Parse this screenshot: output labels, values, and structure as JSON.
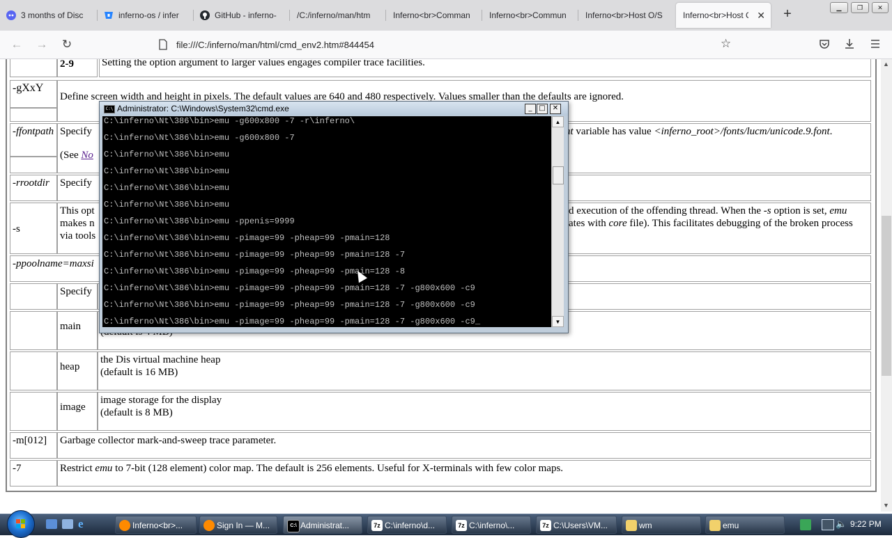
{
  "browser": {
    "tabs": [
      {
        "label": "3 months of Disc",
        "icon": "discord-icon"
      },
      {
        "label": "inferno-os / infer",
        "icon": "bitbucket-icon"
      },
      {
        "label": "GitHub - inferno-",
        "icon": "github-icon"
      },
      {
        "label": "/C:/inferno/man/htm",
        "icon": "none"
      },
      {
        "label": "Inferno<br>Comman",
        "icon": "none"
      },
      {
        "label": "Inferno<br>Commun",
        "icon": "none"
      },
      {
        "label": "Inferno<br>Host O/S",
        "icon": "none"
      },
      {
        "label": "Inferno<br>Host O",
        "icon": "none",
        "active": true
      }
    ],
    "url": "file:///C:/inferno/man/html/cmd_env2.htm#844454"
  },
  "page": {
    "row_29": {
      "flag": "2-9",
      "text": "Setting the option argument to larger values engages compiler trace facilities."
    },
    "row_g": {
      "flag": "-gXxY",
      "text": "Define screen width and height in pixels. The default values are 640 and 480 respectively. Values smaller than the defaults are ignored."
    },
    "row_f": {
      "flag": "-ffontpath",
      "text_left": "Specify",
      "text_right_1": "nt",
      "text_right_2": " variable has value ",
      "text_right_3": "<inferno_root>/fonts/lucm/unicode.9.font",
      "text_right_4": ".",
      "see_prefix": "(See ",
      "see_link": "No"
    },
    "row_r": {
      "flag": "-rrootdir",
      "text": "Specify"
    },
    "row_s": {
      "flag": "-s",
      "line1_left": "This opt",
      "line1_right_a": "d execution of the offending thread. When the ",
      "line1_right_b": "-s",
      "line1_right_c": " option is set, ",
      "line1_right_d": "emu",
      "line2_left": "makes n",
      "line2_right_a": "ates with ",
      "line2_right_b": "core",
      "line2_right_c": " file). This facilitates debugging of the broken process",
      "line3_left": "via tools"
    },
    "row_p": {
      "flag": "-ppoolname=maxsi"
    },
    "row_specify": {
      "text": "Specify"
    },
    "row_main": {
      "name": "main",
      "line2": "(default is 4 MB)"
    },
    "row_heap": {
      "name": "heap",
      "line1": "the Dis virtual machine heap",
      "line2": "(default is 16 MB)"
    },
    "row_image": {
      "name": "image",
      "line1": "image storage for the display",
      "line2": "(default is 8 MB)"
    },
    "row_m": {
      "flag": "-m[012]",
      "text": "Garbage collector mark-and-sweep trace parameter."
    },
    "row_7": {
      "flag": "-7",
      "text_a": "Restrict ",
      "text_b": "emu",
      "text_c": " to 7-bit (128 element) color map. The default is 256 elements. Useful for X-terminals with few color maps."
    }
  },
  "cmd": {
    "title": "Administrator: C:\\Windows\\System32\\cmd.exe",
    "lines": [
      "C:\\inferno\\Nt\\386\\bin>emu -g600x800 -7 -r\\inferno\\",
      "C:\\inferno\\Nt\\386\\bin>emu -g600x800 -7",
      "C:\\inferno\\Nt\\386\\bin>emu",
      "C:\\inferno\\Nt\\386\\bin>emu",
      "C:\\inferno\\Nt\\386\\bin>emu",
      "C:\\inferno\\Nt\\386\\bin>emu",
      "C:\\inferno\\Nt\\386\\bin>emu -ppenis=9999",
      "C:\\inferno\\Nt\\386\\bin>emu -pimage=99 -pheap=99 -pmain=128",
      "C:\\inferno\\Nt\\386\\bin>emu -pimage=99 -pheap=99 -pmain=128 -7",
      "C:\\inferno\\Nt\\386\\bin>emu -pimage=99 -pheap=99 -pmain=128 -8",
      "C:\\inferno\\Nt\\386\\bin>emu -pimage=99 -pheap=99 -pmain=128 -7 -g800x600 -c9",
      "C:\\inferno\\Nt\\386\\bin>emu -pimage=99 -pheap=99 -pmain=128 -7 -g800x600 -c9",
      "C:\\inferno\\Nt\\386\\bin>emu -pimage=99 -pheap=99 -pmain=128 -7 -g800x600 -c9_"
    ]
  },
  "taskbar": {
    "buttons": [
      {
        "label": "Inferno<br>...",
        "icon": "firefox-icon"
      },
      {
        "label": "Sign In — M...",
        "icon": "firefox-icon"
      },
      {
        "label": "Administrat...",
        "icon": "cmd-icon",
        "active": true
      },
      {
        "label": "C:\\inferno\\d...",
        "icon": "7zip-icon"
      },
      {
        "label": "C:\\inferno\\...",
        "icon": "7zip-icon"
      },
      {
        "label": "C:\\Users\\VM...",
        "icon": "7zip-icon"
      },
      {
        "label": "wm",
        "icon": "folder-icon"
      },
      {
        "label": "emu",
        "icon": "folder-icon"
      }
    ],
    "clock": "9:22 PM"
  }
}
